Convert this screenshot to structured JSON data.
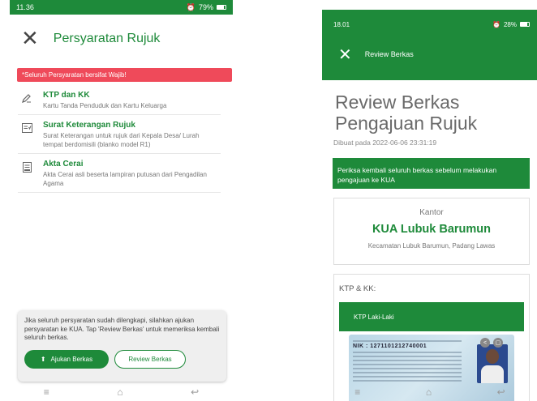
{
  "left": {
    "status": {
      "time": "11.36",
      "battery": "79%"
    },
    "header": {
      "title": "Persyaratan Rujuk"
    },
    "alert": "*Seluruh Persyaratan bersifat Wajib!",
    "requirements": [
      {
        "title": "KTP dan KK",
        "desc": "Kartu Tanda Penduduk dan Kartu Keluarga",
        "icon": "pencil-icon"
      },
      {
        "title": "Surat Keterangan Rujuk",
        "desc": "Surat Keterangan untuk rujuk dari Kepala Desa/ Lurah tempat berdomisili (blanko model R1)",
        "icon": "document-icon"
      },
      {
        "title": "Akta Cerai",
        "desc": "Akta Cerai asli beserta lampiran putusan dari Pengadilan Agama",
        "icon": "certificate-icon"
      }
    ],
    "bottom": {
      "info": "Jika seluruh persyaratan sudah dilengkapi, silahkan ajukan persyaratan ke KUA. Tap 'Review Berkas' untuk memeriksa kembali seluruh berkas.",
      "submit_label": "Ajukan Berkas",
      "review_label": "Review Berkas"
    }
  },
  "right": {
    "status": {
      "time": "18.01",
      "battery": "28%"
    },
    "header": {
      "title": "Review Berkas"
    },
    "title": "Review Berkas Pengajuan Rujuk",
    "date": "Dibuat pada 2022-06-06 23:31:19",
    "note": "Periksa kembali seluruh berkas sebelum melakukan pengajuan ke KUA",
    "office": {
      "label": "Kantor",
      "name": "KUA Lubuk Barumun",
      "location": "Kecamatan Lubuk Barumun, Padang Lawas"
    },
    "docs": {
      "label": "KTP & KK:",
      "card_title": "KTP Laki-Laki",
      "nik": "NIK : 1271101212740001"
    }
  },
  "colors": {
    "primary": "#1e8a3a",
    "alert": "#ef4a5a"
  }
}
